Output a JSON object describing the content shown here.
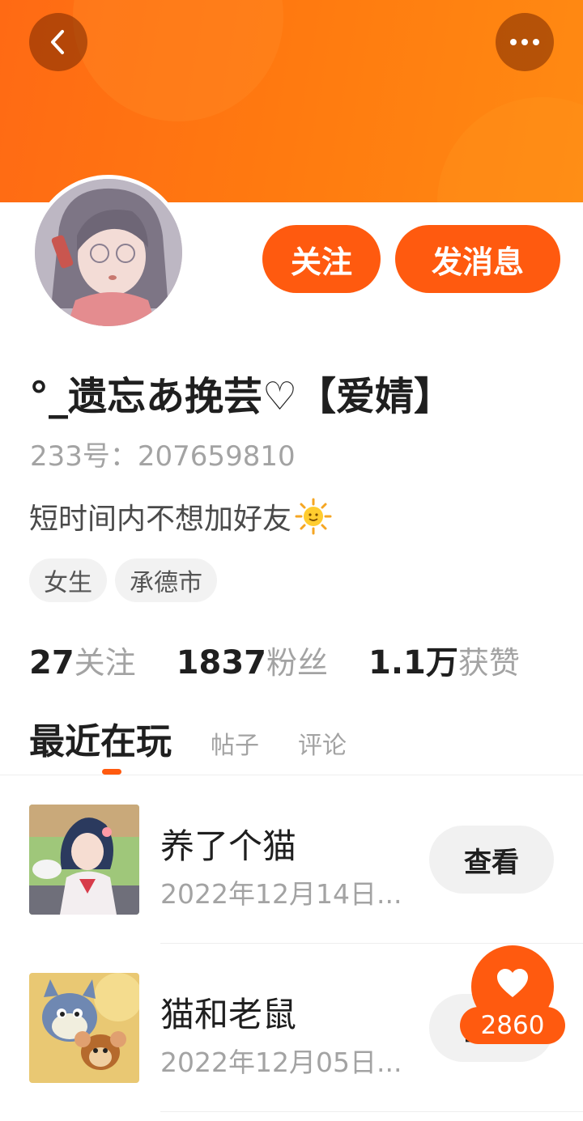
{
  "header": {
    "back_icon": "chevron-left-icon",
    "more_icon": "more-dots-icon",
    "banner_color": "#ff7a10"
  },
  "profile": {
    "follow_label": "关注",
    "message_label": "发消息",
    "username": "°_遗忘あ挽芸♡【爱婧】",
    "uid_label": "233号：",
    "uid": "207659810",
    "bio": "短时间内不想加好友",
    "bio_emoji": "sun-emoji-icon",
    "tags": [
      "女生",
      "承德市"
    ]
  },
  "stats": [
    {
      "num": "27",
      "label": "关注"
    },
    {
      "num": "1837",
      "label": "粉丝"
    },
    {
      "num": "1.1万",
      "label": "获赞"
    }
  ],
  "tabs": [
    {
      "label": "最近在玩",
      "active": true
    },
    {
      "label": "帖子",
      "active": false
    },
    {
      "label": "评论",
      "active": false
    }
  ],
  "games": [
    {
      "name": "养了个猫",
      "date": "2022年12月14日...",
      "button": "查看"
    },
    {
      "name": "猫和老鼠",
      "date": "2022年12月05日...",
      "button": "查看"
    }
  ],
  "like": {
    "icon": "heart-icon",
    "count": "2860"
  },
  "colors": {
    "accent": "#ff5a0f",
    "muted_text": "#a3a3a3"
  }
}
